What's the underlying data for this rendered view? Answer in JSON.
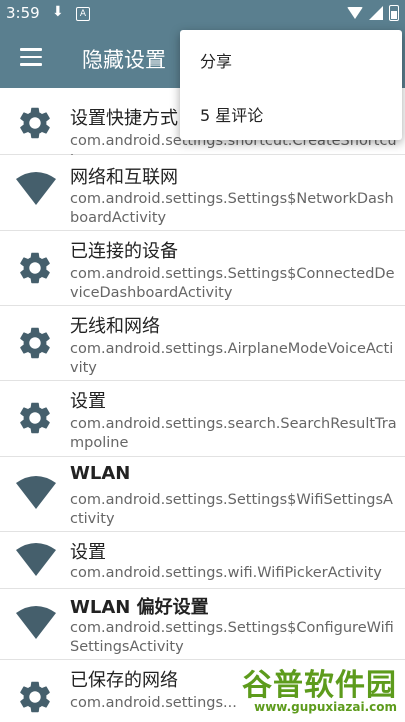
{
  "status_bar": {
    "time": "3:59"
  },
  "app_bar": {
    "title": "隐藏设置"
  },
  "menu": {
    "items": [
      "分享",
      "5 星评论"
    ]
  },
  "list": [
    {
      "title": "设置快捷方式",
      "subtitle": "com.android.settings.shortcut.CreateShortcut",
      "icon": "gear-icon"
    },
    {
      "title": "网络和互联网",
      "subtitle": "com.android.settings.Settings$NetworkDashboardActivity",
      "icon": "wifi-icon"
    },
    {
      "title": "已连接的设备",
      "subtitle": "com.android.settings.Settings$ConnectedDeviceDashboardActivity",
      "icon": "gear-icon"
    },
    {
      "title": "无线和网络",
      "subtitle": "com.android.settings.AirplaneModeVoiceActivity",
      "icon": "gear-icon"
    },
    {
      "title": "设置",
      "subtitle": "com.android.settings.search.SearchResultTrampoline",
      "icon": "gear-icon"
    },
    {
      "title": "WLAN",
      "subtitle": "com.android.settings.Settings$WifiSettingsActivity",
      "icon": "wifi-icon"
    },
    {
      "title": "设置",
      "subtitle": "com.android.settings.wifi.WifiPickerActivity",
      "icon": "wifi-icon"
    },
    {
      "title": "WLAN 偏好设置",
      "subtitle": "com.android.settings.Settings$ConfigureWifiSettingsActivity",
      "icon": "wifi-icon"
    },
    {
      "title": "已保存的网络",
      "subtitle": "com.android.settings...",
      "icon": "gear-icon"
    }
  ],
  "watermark": {
    "text": "谷普软件园",
    "url": "www.gupuxiazai.com"
  },
  "colors": {
    "app_bar": "#5a7f8f",
    "icon": "#455f6c"
  }
}
